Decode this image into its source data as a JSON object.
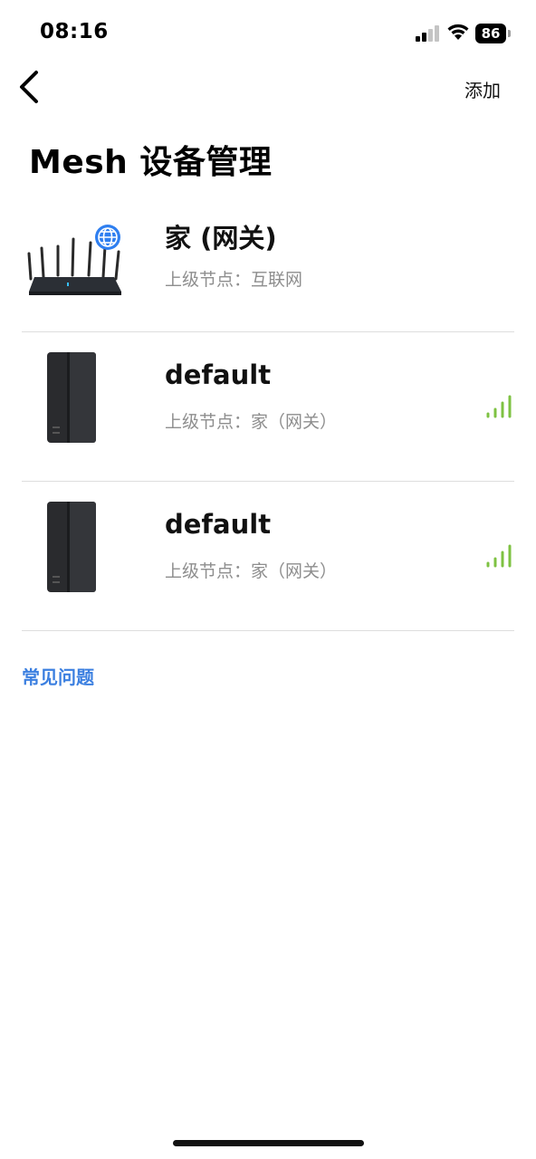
{
  "status_bar": {
    "time": "08:16",
    "battery": "86"
  },
  "nav": {
    "add_label": "添加"
  },
  "page": {
    "title": "Mesh 设备管理"
  },
  "devices": [
    {
      "name": "家 (网关)",
      "parent": "上级节点：互联网",
      "type": "gateway-router",
      "badge": "globe-icon"
    },
    {
      "name": "default",
      "parent": "上级节点：家（网关）",
      "type": "mesh-node",
      "signal_color": "#7ec242"
    },
    {
      "name": "default",
      "parent": "上级节点：家（网关）",
      "type": "mesh-node",
      "signal_color": "#7ec242"
    }
  ],
  "faq": {
    "label": "常见问题"
  },
  "colors": {
    "accent": "#3b7fe0",
    "signal": "#7ec242",
    "divider": "#dedede"
  }
}
